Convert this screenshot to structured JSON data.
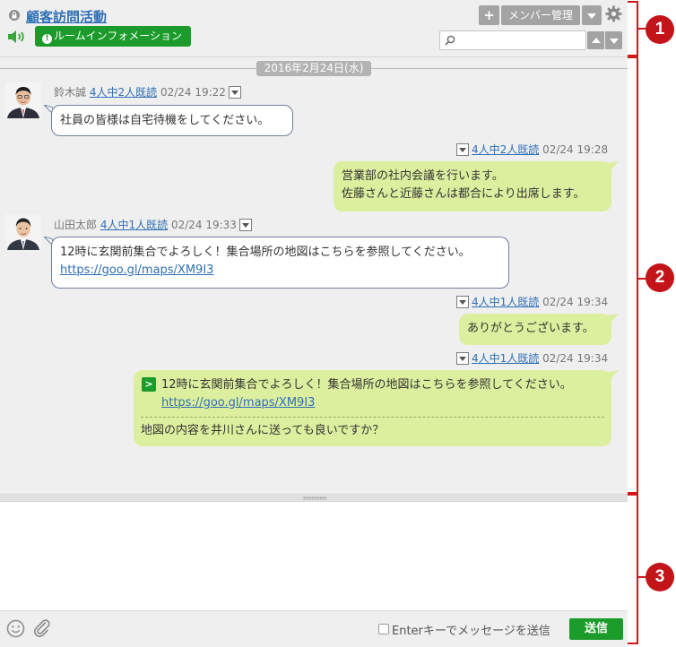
{
  "header": {
    "room_title": "顧客訪問活動",
    "room_info_label": "ルームインフォメーション",
    "add_label": "+",
    "member_manage_label": "メンバー管理",
    "search_placeholder": ""
  },
  "messages": {
    "date_label": "2016年2月24日(水)",
    "items": [
      {
        "sender": "鈴木誠",
        "read": "4人中2人既読",
        "time": "02/24 19:22",
        "lines": [
          "社員の皆様は自宅待機をしてください。"
        ]
      },
      {
        "read": "4人中2人既読",
        "time": "02/24 19:28",
        "lines": [
          "営業部の社内会議を行います。",
          "佐藤さんと近藤さんは都合により出席します。"
        ]
      },
      {
        "sender": "山田太郎",
        "read": "4人中1人既読",
        "time": "02/24 19:33",
        "lines": [
          "12時に玄関前集合でよろしく！集合場所の地図はこちらを参照してください。"
        ],
        "link": "https://goo.gl/maps/XM9I3"
      },
      {
        "read": "4人中1人既読",
        "time": "02/24 19:34",
        "lines": [
          "ありがとうございます。"
        ]
      },
      {
        "read": "4人中1人既読",
        "time": "02/24 19:34",
        "quote_badge": ">",
        "quote_text": "12時に玄関前集合でよろしく！集合場所の地図はこちらを参照してください。",
        "quote_link": "https://goo.gl/maps/XM9I3",
        "reply": "地図の内容を井川さんに送っても良いですか？"
      }
    ]
  },
  "composer": {
    "message_value": "",
    "enter_send_label": "Enterキーでメッセージを送信",
    "send_label": "送信"
  },
  "callouts": [
    "1",
    "2",
    "3"
  ],
  "colors": {
    "accent_green": "#1a9b2a",
    "link_blue": "#2f6fb5",
    "bubble_out": "#dcef9e",
    "callout_red": "#c3141a"
  }
}
